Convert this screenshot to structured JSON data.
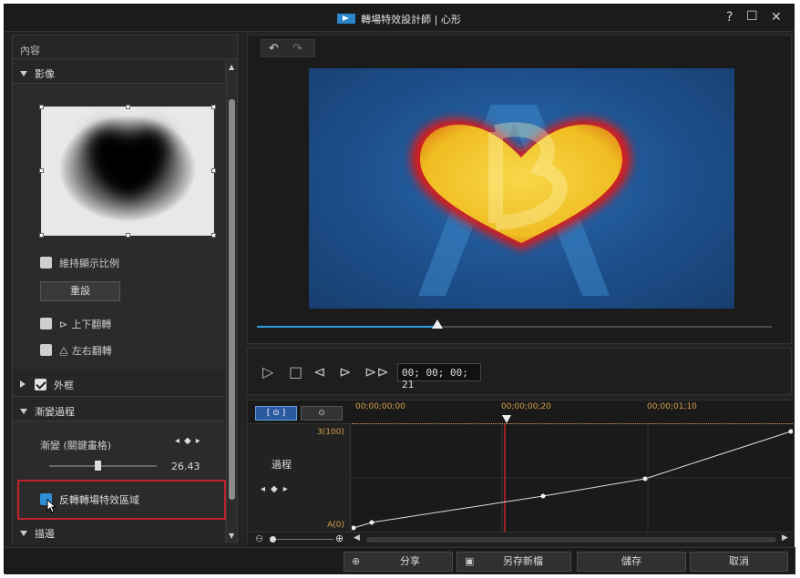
{
  "window": {
    "title": "轉場特效設計師 | 心形",
    "help": "?",
    "maximize": "☐",
    "close": "✕"
  },
  "left_panel": {
    "header": "內容",
    "section_image": "影像",
    "keep_ratio": "維持顯示比例",
    "reset": "重設",
    "flip_vertical": "上下翻轉",
    "flip_horizontal": "左右翻轉",
    "section_border": "外框",
    "section_transition": "漸變過程",
    "transition_label": "漸變 (關鍵畫格)",
    "transition_value": "26.43",
    "slider_fraction": 0.45,
    "invert_label": "反轉轉場特效區域",
    "section_stroke": "描邊"
  },
  "player": {
    "timecode": "00; 00; 00; 21",
    "seek_fraction": 0.35
  },
  "timeline": {
    "tab1": "[ ⊙ ]",
    "tab2": "⊙",
    "ruler": [
      "00;00;00;00",
      "00;00;00;20",
      "00;00;01;10"
    ],
    "track_label": "過程",
    "y_max": "3(100)",
    "y_min": "A(0)"
  },
  "bottom": {
    "share": "分享",
    "save_as": "另存新檔",
    "save": "儲存",
    "cancel": "取消"
  },
  "colors": {
    "accent": "#2f9be0",
    "highlight": "#c0242a",
    "heart_fill": "#f2c12e",
    "heart_glow": "#d41a1a"
  }
}
